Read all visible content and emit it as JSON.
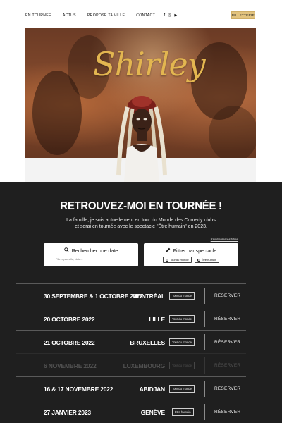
{
  "nav": {
    "items": [
      "EN TOURNÉE",
      "ACTUS",
      "PROPOSE TA VILLE",
      "CONTACT"
    ],
    "social": [
      {
        "icon": "facebook-icon",
        "glyph": "f"
      },
      {
        "icon": "instagram-icon",
        "glyph": "◎"
      },
      {
        "icon": "youtube-icon",
        "glyph": "▶"
      }
    ],
    "ticket_label": "BILLETTERIE"
  },
  "hero": {
    "logo_text": "Shirley"
  },
  "main": {
    "title": "RETROUVEZ-MOI EN TOURNÉE !",
    "intro_line1": "La famille, je suis actuellement en tour du Monde des Comedy clubs",
    "intro_line2": "et serai en tournée avec le spectacle \"Être humain\" en 2023.",
    "reset_filters": "Réinitialiser les filtres",
    "date_filter": {
      "title": "Rechercher une date",
      "icon": "search-icon",
      "placeholder": "Filtrer par ville, date..."
    },
    "show_filter": {
      "title": "Filtrer par spectacle",
      "icon": "pencil-icon",
      "options": [
        "Tour du monde",
        "Être humain"
      ]
    }
  },
  "tour": [
    {
      "date": "30 SEPTEMBRE & 1 OCTOBRE 2022",
      "city": "MONTRÉAL",
      "show": "Tour du monde",
      "action": "RÉSERVER"
    },
    {
      "date": "20 OCTOBRE 2022",
      "city": "LILLE",
      "show": "Tour du monde",
      "action": "RÉSERVER"
    },
    {
      "date": "21 OCTOBRE 2022",
      "city": "BRUXELLES",
      "show": "Tour du monde",
      "action": "RÉSERVER"
    },
    {
      "date": "6 NOVEMBRE 2022",
      "city": "LUXEMBOURG",
      "show": "Tour du monde",
      "action": "RÉSERVER"
    },
    {
      "date": "16 & 17 NOVEMBRE 2022",
      "city": "ABIDJAN",
      "show": "Tour du monde",
      "action": "RÉSERVER"
    },
    {
      "date": "27 JANVIER 2023",
      "city": "GENÈVE",
      "show": "Être humain",
      "action": "RÉSERVER"
    }
  ],
  "colors": {
    "accent": "#e2c37e",
    "logo": "#e3b650",
    "background_dark": "#1f1f1f"
  }
}
